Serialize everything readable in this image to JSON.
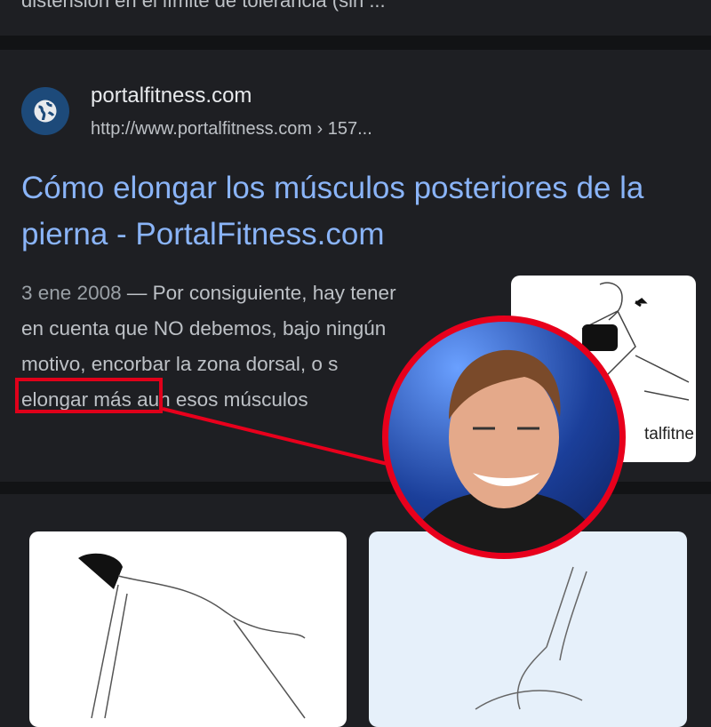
{
  "previous_result": {
    "snippet_tail": "distensión en el límite de tolerancia (sin ..."
  },
  "result": {
    "favicon_icon": "globe-icon",
    "site_name": "portalfitness.com",
    "url": "http://www.portalfitness.com › 157...",
    "title": "Cómo elongar los músculos posteriores de la pierna - PortalFitness.com",
    "date": "3 ene 2008",
    "snippet_lines": [
      "— Por consiguiente, hay tener",
      "en cuenta que NO debemos, bajo ningún",
      "motivo, encorbar la zona dorsal, o s",
      "elongar más aun esos músculos"
    ],
    "thumbnail_caption": "talfitne"
  },
  "annotation": {
    "highlight_text": "elongar más",
    "color": "#e8001c"
  }
}
